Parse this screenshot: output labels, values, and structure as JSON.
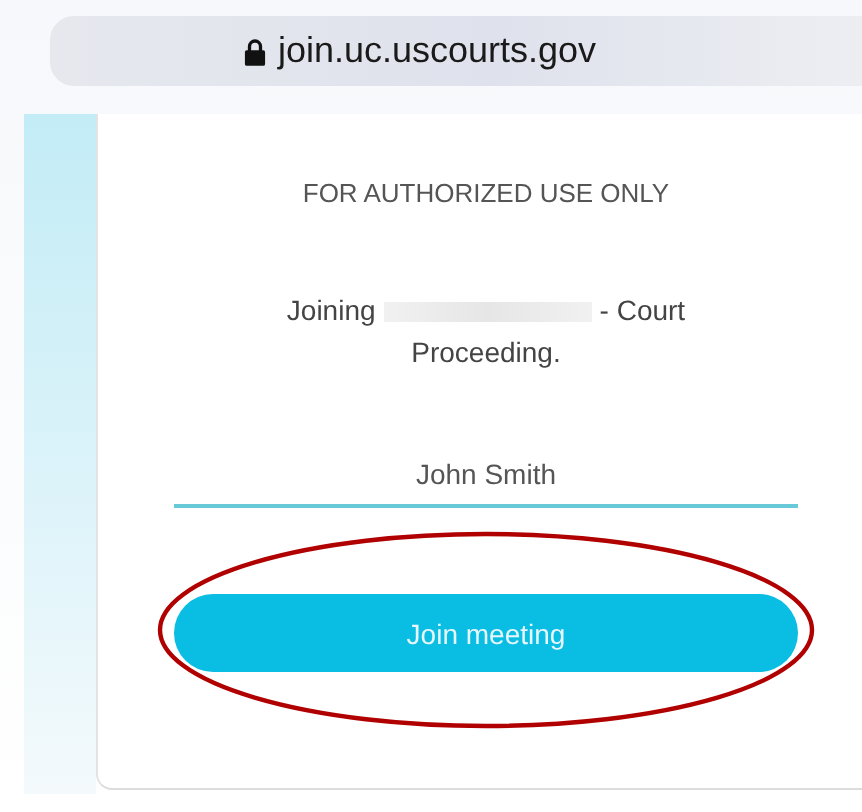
{
  "address_bar": {
    "secure": true,
    "url": "join.uc.uscourts.gov"
  },
  "notice": "FOR AUTHORIZED USE ONLY",
  "joining": {
    "prefix": "Joining",
    "redacted": true,
    "suffix": "- Court Proceeding."
  },
  "name_field": {
    "value": "John Smith"
  },
  "join_button": {
    "label": "Join meeting",
    "highlighted": true
  }
}
